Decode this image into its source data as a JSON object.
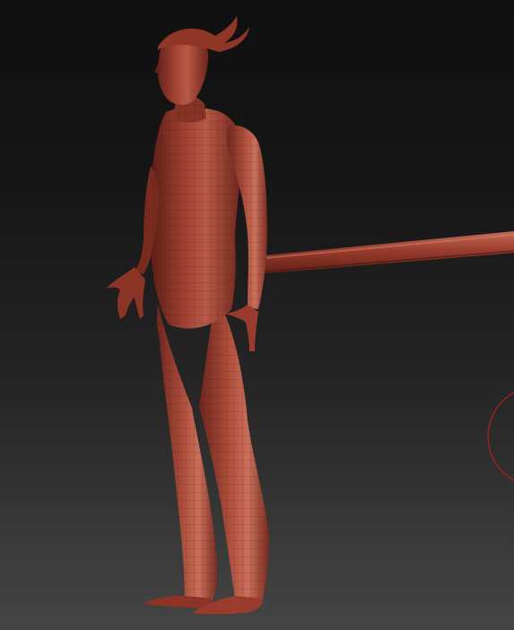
{
  "viewport": {
    "background_top": "#101010",
    "background_bottom": "#454545"
  },
  "model": {
    "kind": "humanoid-figure",
    "material": "red-wax",
    "material_color": "#9b3e30",
    "shadow_color": "#3e120d",
    "highlight_color": "#d6836f",
    "display": "polyframe-mesh"
  },
  "rod": {
    "color": "#8a3326"
  },
  "brush_cursor": {
    "color": "#b01e1e"
  }
}
